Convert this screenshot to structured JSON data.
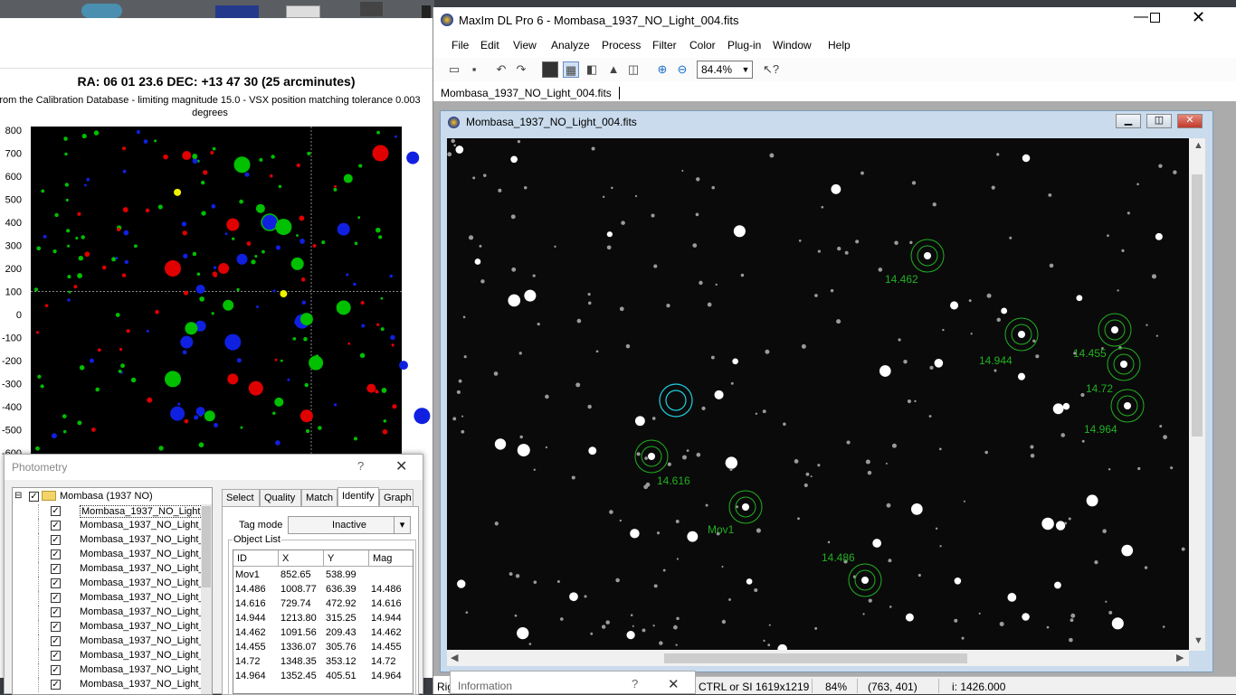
{
  "chart": {
    "title": "RA: 06 01 23.6  DEC: +13 47  30 (25 arcminutes)",
    "subtitle_line1": "rom the Calibration Database - limiting magnitude 15.0 - VSX position matching tolerance 0.003",
    "subtitle_line2": "degrees"
  },
  "chart_data": {
    "type": "scatter",
    "title": "RA: 06 01 23.6  DEC: +13 47  30 (25 arcminutes)",
    "y_ticks": [
      "800",
      "700",
      "600",
      "500",
      "400",
      "300",
      "200",
      "100",
      "0",
      "-100",
      "-200",
      "-300",
      "-400",
      "-500",
      "-600"
    ],
    "ylim": [
      -600,
      800
    ],
    "crosshair": {
      "x": 0,
      "y": 100
    },
    "colors": {
      "green": "#00c000",
      "red": "#e00000",
      "blue": "#1020e0",
      "yellow": "#f0f000",
      "background": "#000000"
    },
    "series": [
      {
        "color": "#1020e0",
        "points": [
          [
            -240,
            110
          ],
          [
            -270,
            -120
          ],
          [
            -170,
            -120
          ],
          [
            -240,
            -50
          ],
          [
            -290,
            -430
          ],
          [
            -240,
            -420
          ],
          [
            70,
            370
          ],
          [
            -90,
            400
          ],
          [
            -150,
            240
          ],
          [
            -20,
            -30
          ],
          [
            200,
            -220
          ],
          [
            220,
            680
          ],
          [
            240,
            -440
          ]
        ]
      },
      {
        "color": "#e00000",
        "points": [
          [
            -270,
            690
          ],
          [
            -170,
            390
          ],
          [
            -300,
            200
          ],
          [
            -170,
            -280
          ],
          [
            -120,
            -320
          ],
          [
            130,
            -320
          ],
          [
            -10,
            -440
          ],
          [
            150,
            700
          ],
          [
            -190,
            200
          ]
        ]
      },
      {
        "color": "#00c000",
        "points": [
          [
            -110,
            460
          ],
          [
            -30,
            220
          ],
          [
            -60,
            380
          ],
          [
            -220,
            -440
          ],
          [
            10,
            -210
          ],
          [
            -70,
            -380
          ],
          [
            -10,
            -20
          ],
          [
            -300,
            -280
          ],
          [
            -180,
            40
          ],
          [
            70,
            30
          ],
          [
            80,
            590
          ],
          [
            -260,
            -60
          ],
          [
            -150,
            650
          ]
        ]
      },
      {
        "color": "#f0f000",
        "points": [
          [
            -290,
            530
          ],
          [
            -60,
            90
          ]
        ]
      }
    ]
  },
  "photometry": {
    "title": "Photometry",
    "help": "?",
    "close": "✕",
    "tree_root": "Mombasa (1937 NO)",
    "tree_item": "Mombasa_1937_NO_Light_",
    "tree_count": 13,
    "tabs": [
      "Select",
      "Quality",
      "Match",
      "Identify",
      "Graph"
    ],
    "tag_mode_label": "Tag mode",
    "tag_mode_value": "Inactive",
    "object_list_label": "Object List",
    "columns": [
      "ID",
      "X",
      "Y",
      "Mag"
    ],
    "rows": [
      [
        "Mov1",
        "852.65",
        "538.99",
        ""
      ],
      [
        "14.486",
        "1008.77",
        "636.39",
        "14.486"
      ],
      [
        "14.616",
        "729.74",
        "472.92",
        "14.616"
      ],
      [
        "14.944",
        "1213.80",
        "315.25",
        "14.944"
      ],
      [
        "14.462",
        "1091.56",
        "209.43",
        "14.462"
      ],
      [
        "14.455",
        "1336.07",
        "305.76",
        "14.455"
      ],
      [
        "14.72",
        "1348.35",
        "353.12",
        "14.72"
      ],
      [
        "14.964",
        "1352.45",
        "405.51",
        "14.964"
      ]
    ]
  },
  "maxim": {
    "title": "MaxIm DL Pro 6 - Mombasa_1937_NO_Light_004.fits",
    "menu": [
      "File",
      "Edit",
      "View",
      "Analyze",
      "Process",
      "Filter",
      "Color",
      "Plug-in",
      "Window",
      "Help"
    ],
    "zoom": "84.4%",
    "doc_tab": "Mombasa_1937_NO_Light_004.fits",
    "child_title": "Mombasa_1937_NO_Light_004.fits",
    "star_labels": [
      "14.462",
      "14.944",
      "14.455",
      "14.72",
      "14.964",
      "14.616",
      "Mov1",
      "14.486"
    ]
  },
  "status": {
    "left": "Rig",
    "keys": "CTRL or SI 1619x1219",
    "zoom": "84%",
    "coords": "(763, 401)",
    "intensity": "i:  1426.000"
  },
  "information": {
    "title": "Information",
    "help": "?",
    "close": "✕"
  }
}
